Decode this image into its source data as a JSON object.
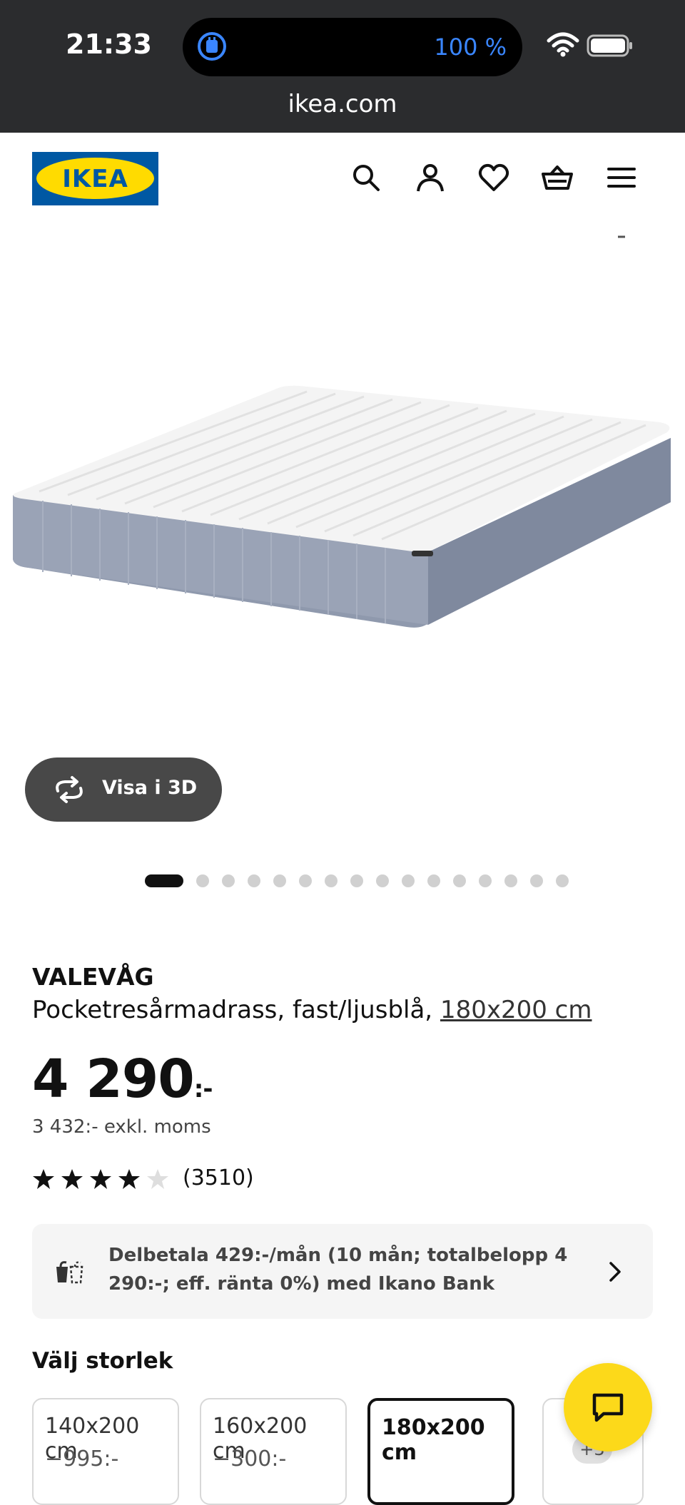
{
  "status_bar": {
    "time": "21:33",
    "battery_percent": "100 %"
  },
  "browser": {
    "url": "ikea.com"
  },
  "header": {
    "logo_text": "IKEA",
    "icons": [
      "search-icon",
      "account-icon",
      "heart-icon",
      "basket-icon",
      "menu-icon"
    ]
  },
  "gallery": {
    "view_3d_label": "Visa i 3D",
    "image_count": 16,
    "active_index": 0
  },
  "product": {
    "name": "VALEVÅG",
    "description": "Pocketresårmadrass, fast/ljusblå,",
    "size_link": "180x200 cm",
    "price": "4 290",
    "price_suffix": ":-",
    "price_ex_vat": "3 432:- exkl. moms",
    "rating": 4,
    "rating_max": 5,
    "review_count": "(3510)"
  },
  "finance": {
    "text": "Delbetala 429:-/mån (10 mån; totalbelopp 4 290:-; eff. ränta 0%) med Ikano Bank"
  },
  "sizes": {
    "heading": "Välj storlek",
    "options": [
      {
        "size": "140x200 cm",
        "diff": "−995:-",
        "selected": false
      },
      {
        "size": "160x200 cm",
        "diff": "−300:-",
        "selected": false
      },
      {
        "size": "180x200 cm",
        "diff": "",
        "selected": true
      },
      {
        "size": "",
        "diff": "",
        "chip": "+3",
        "selected": false
      }
    ]
  },
  "colors": {
    "ikea_blue": "#0058a3",
    "ikea_yellow": "#ffdb00",
    "chat_yellow": "#fcd91a",
    "status_bar": "#2b2c2e"
  }
}
